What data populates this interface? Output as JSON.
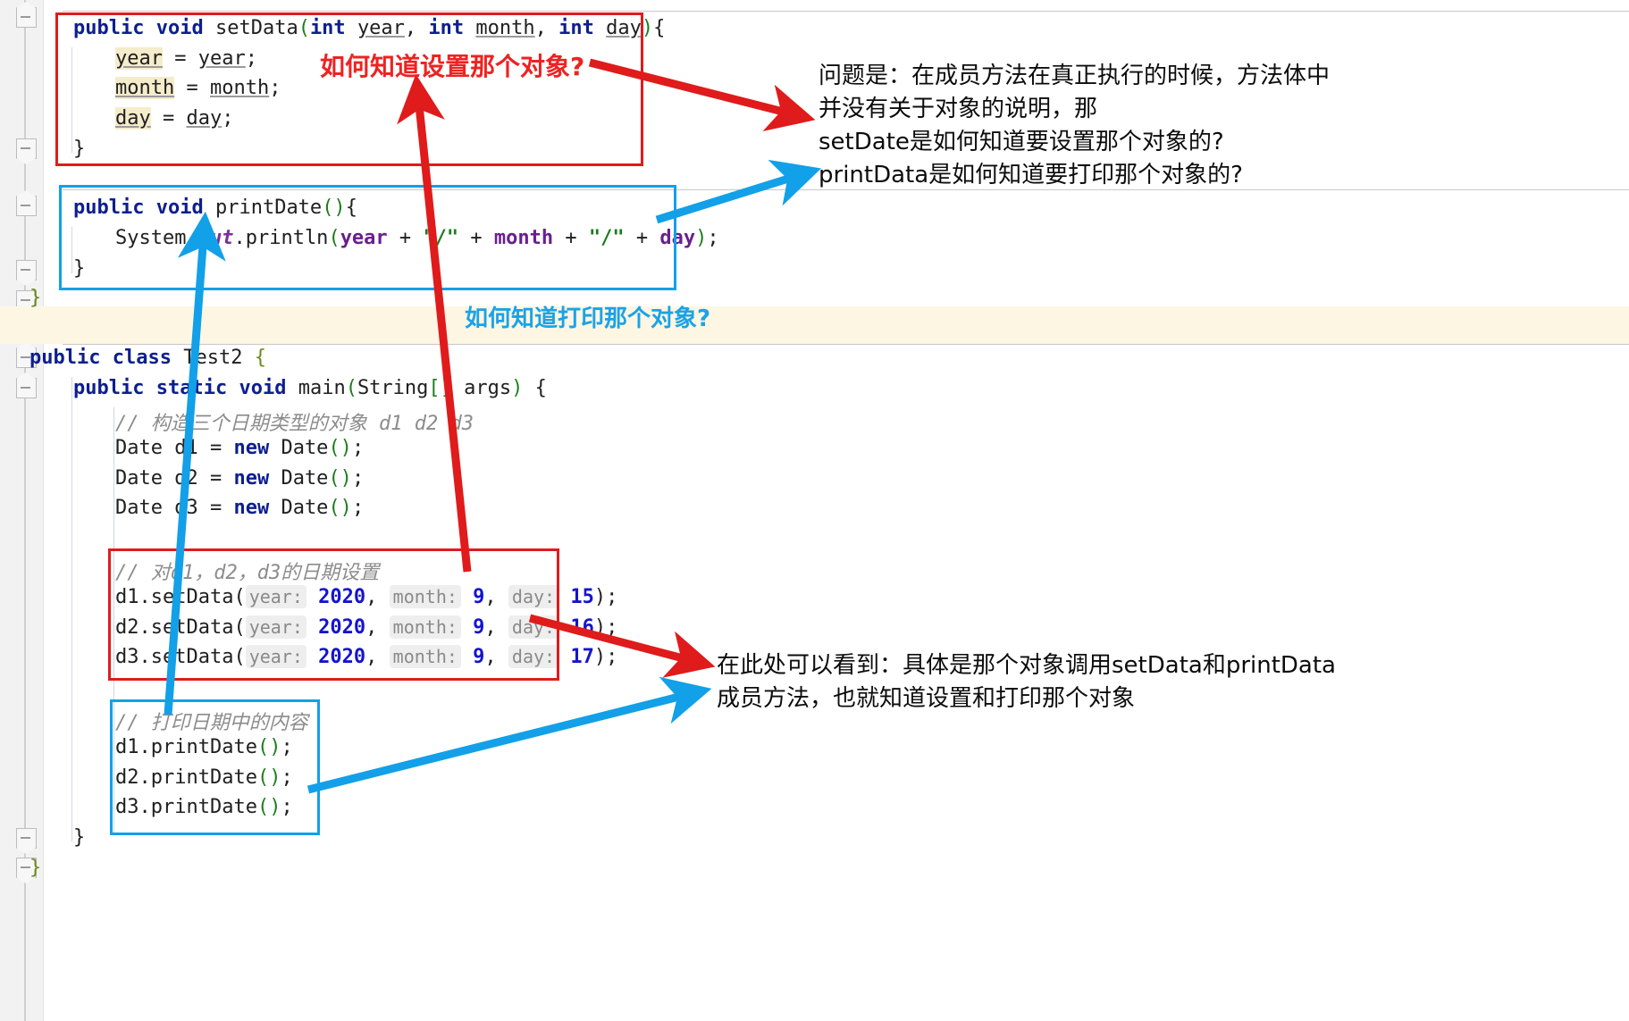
{
  "editor": {
    "gutter_icons": [
      "fold-collapse-icon",
      "fold-collapse-icon",
      "fold-collapse-icon",
      "fold-collapse-icon",
      "fold-collapse-icon",
      "fold-collapse-icon",
      "fold-collapse-icon"
    ]
  },
  "colors": {
    "red": "#e01b1b",
    "blue": "#12a0e8",
    "keyword": "#0d1f8f",
    "string": "#1d7d1d",
    "number": "#1414cf",
    "field": "#6a1f8f",
    "comment": "#8c8c8c",
    "highlight_band": "#fdf6e3",
    "occurrence_highlight": "#f5eccb"
  },
  "code": {
    "setdata_method": {
      "signature_prefix": "public void ",
      "signature_name": "setData",
      "params": "(int year, int month, int day){",
      "line_year": "year = year;",
      "line_month": "month = month;",
      "line_day": "day = day;",
      "close": "}"
    },
    "printdate_method": {
      "signature": "public void printDate(){",
      "body": "System.out.println(year + \"/\" + month + \"/\" + day);",
      "close": "}"
    },
    "outer_class_close": "}",
    "test_class": {
      "declaration": "public class Test2 {",
      "main_signature": "public static void main(String[] args) {",
      "comment_construct": "// 构造三个日期类型的对象 d1 d2 d3",
      "new_lines": [
        "Date d1 = new Date();",
        "Date d2 = new Date();",
        "Date d3 = new Date();"
      ],
      "comment_setdate": "// 对d1，d2，d3的日期设置",
      "setdata_calls": [
        {
          "receiver": "d1.setData(",
          "year_label": "year:",
          "year": "2020",
          "month_label": "month:",
          "month": "9",
          "day_label": "day:",
          "day": "15",
          "tail": ");"
        },
        {
          "receiver": "d2.setData(",
          "year_label": "year:",
          "year": "2020",
          "month_label": "month:",
          "month": "9",
          "day_label": "day:",
          "day": "16",
          "tail": ");"
        },
        {
          "receiver": "d3.setData(",
          "year_label": "year:",
          "year": "2020",
          "month_label": "month:",
          "month": "9",
          "day_label": "day:",
          "day": "17",
          "tail": ");"
        }
      ],
      "comment_print": "// 打印日期中的内容",
      "printdate_calls": [
        "d1.printDate();",
        "d2.printDate();",
        "d3.printDate();"
      ],
      "main_close": "}",
      "class_close": "}"
    }
  },
  "annotations": {
    "red_top": "如何知道设置那个对象?",
    "blue_middle": "如何知道打印那个对象?",
    "black_top_lines": [
      "问题是：在成员方法在真正执行的时候，方法体中",
      "并没有关于对象的说明，那",
      "setDate是如何知道要设置那个对象的?",
      "printData是如何知道要打印那个对象的?"
    ],
    "black_bottom_lines": [
      "在此处可以看到：具体是那个对象调用setData和printData",
      "成员方法，也就知道设置和打印那个对象"
    ]
  }
}
